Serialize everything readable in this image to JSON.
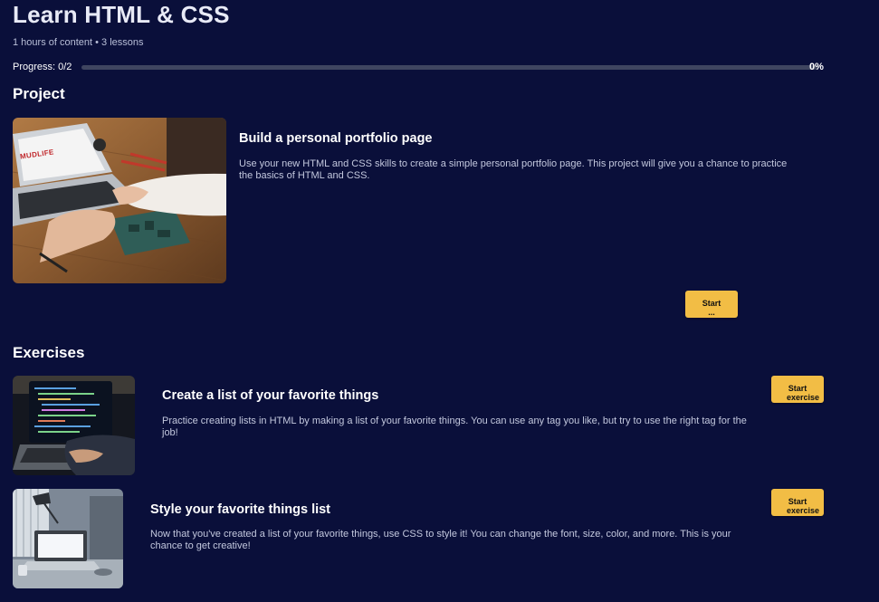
{
  "course": {
    "title": "Learn HTML & CSS",
    "meta": "1 hours of content • 3 lessons"
  },
  "progress": {
    "label": "Progress: 0/2",
    "percent_text": "0%",
    "fraction": 0
  },
  "project_section": {
    "heading": "Project",
    "item": {
      "title": "Build a personal portfolio page",
      "description": "Use your new HTML and CSS skills to create a simple personal portfolio page. This project will give you a chance to practice the basics of HTML and CSS.",
      "button_line1": "Start",
      "button_line2": "..."
    }
  },
  "exercises_section": {
    "heading": "Exercises",
    "items": [
      {
        "title": "Create a list of your favorite things",
        "description": "Practice creating lists in HTML by making a list of your favorite things. You can use any tag you like, but try to use the right tag for the job!",
        "button_line1": "Start",
        "button_line2": "exercise"
      },
      {
        "title": "Style your favorite things list",
        "description": "Now that you've created a list of your favorite things, use CSS to style it! You can change the font, size, color, and more. This is your chance to get creative!",
        "button_line1": "Start",
        "button_line2": "exercise"
      }
    ]
  },
  "colors": {
    "background": "#0a0f3a",
    "accent": "#f2bd45",
    "track": "#3f4560"
  },
  "images": {
    "project_thumb": "laptop-with-circuit-board-photo",
    "exercise_1_thumb": "laptop-with-code-photo",
    "exercise_2_thumb": "desk-with-laptop-photo"
  },
  "logos": {
    "sticker_text": "MUDLIFE"
  }
}
